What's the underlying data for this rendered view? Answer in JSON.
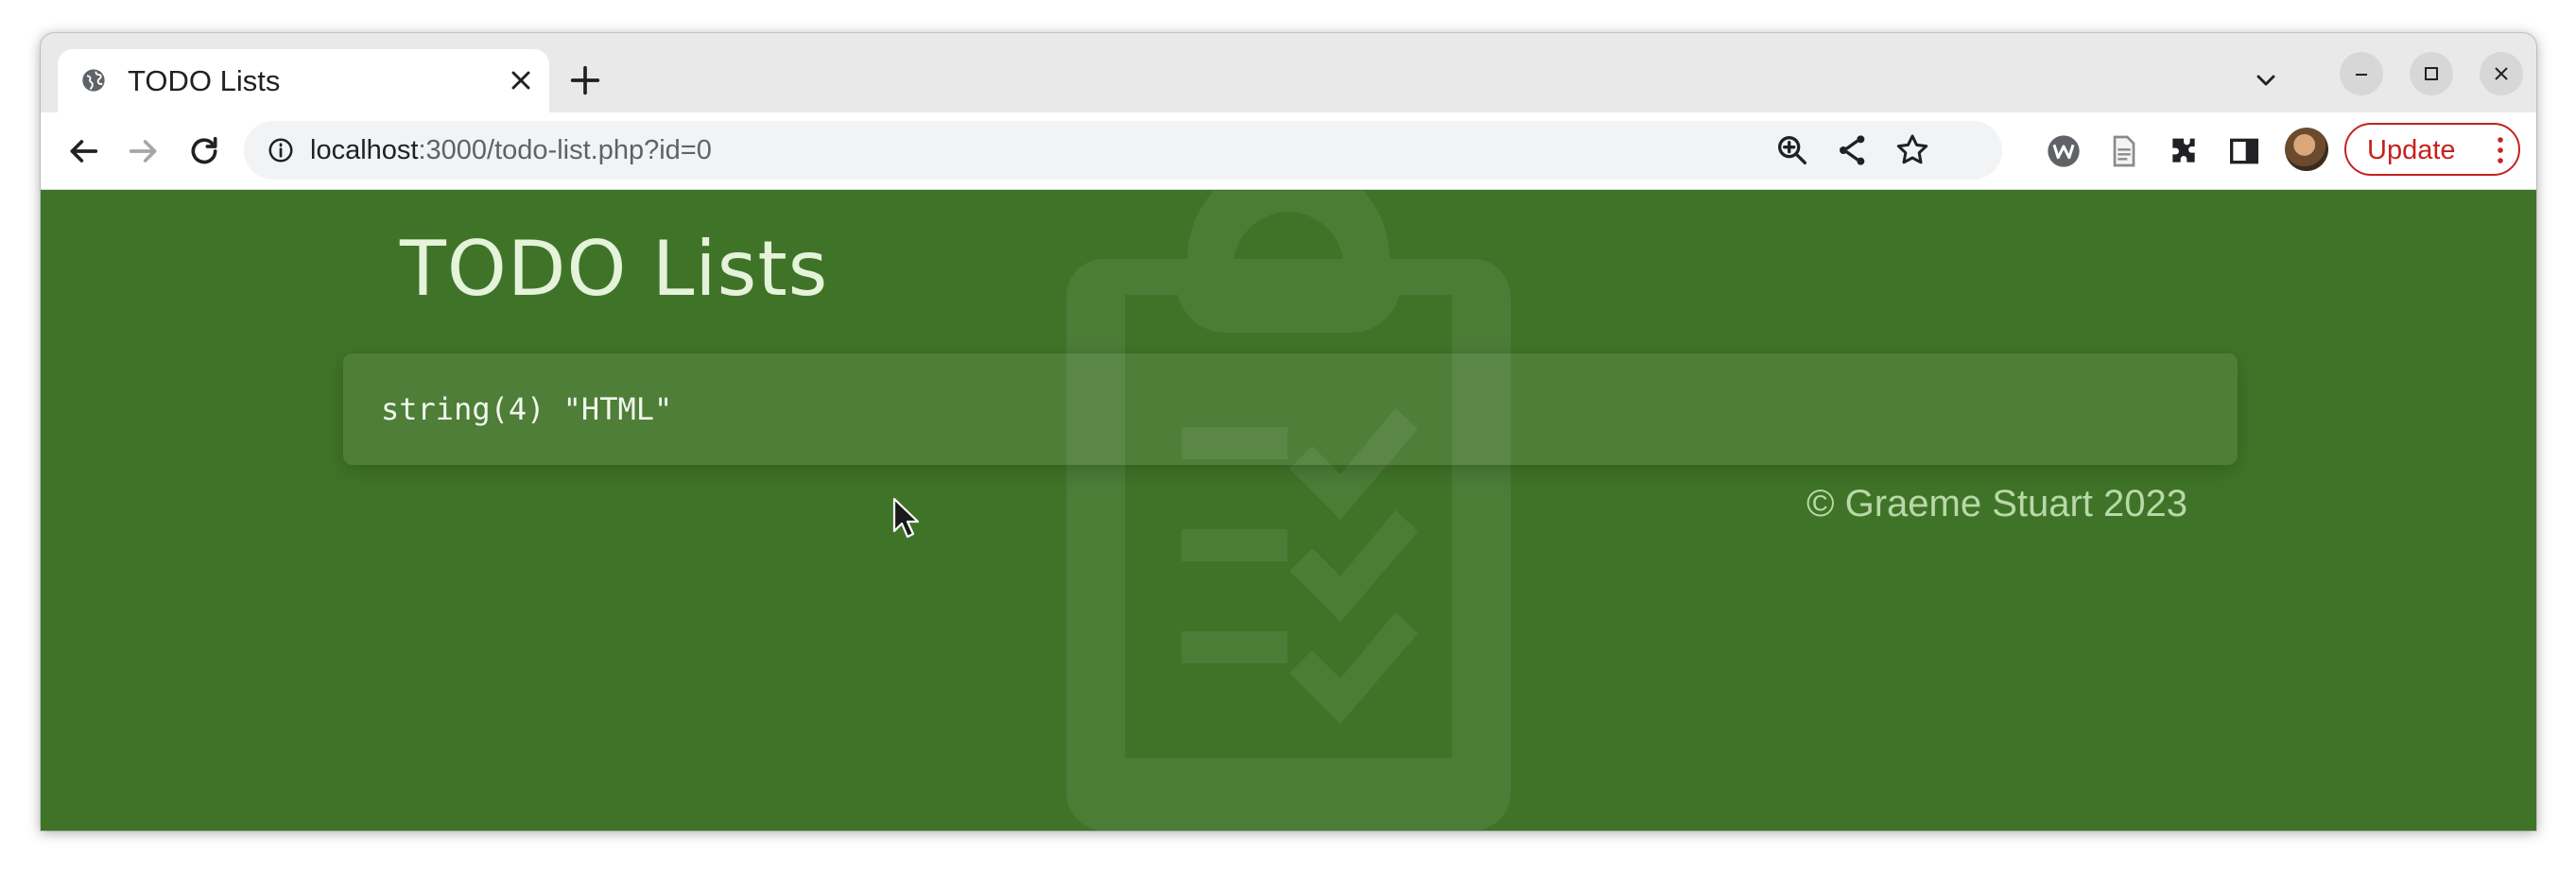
{
  "browser": {
    "tab": {
      "title": "TODO Lists",
      "favicon": "globe-icon"
    },
    "address_bar": {
      "host": "localhost",
      "rest": ":3000/todo-list.php?id=0"
    },
    "update_button": {
      "label": "Update",
      "color": "#c5221f"
    }
  },
  "page": {
    "title": "TODO Lists",
    "output": "string(4) \"HTML\"",
    "footer": "© Graeme Stuart 2023",
    "background_color": "#3f7428",
    "background_icon": "clipboard-checklist-icon"
  }
}
